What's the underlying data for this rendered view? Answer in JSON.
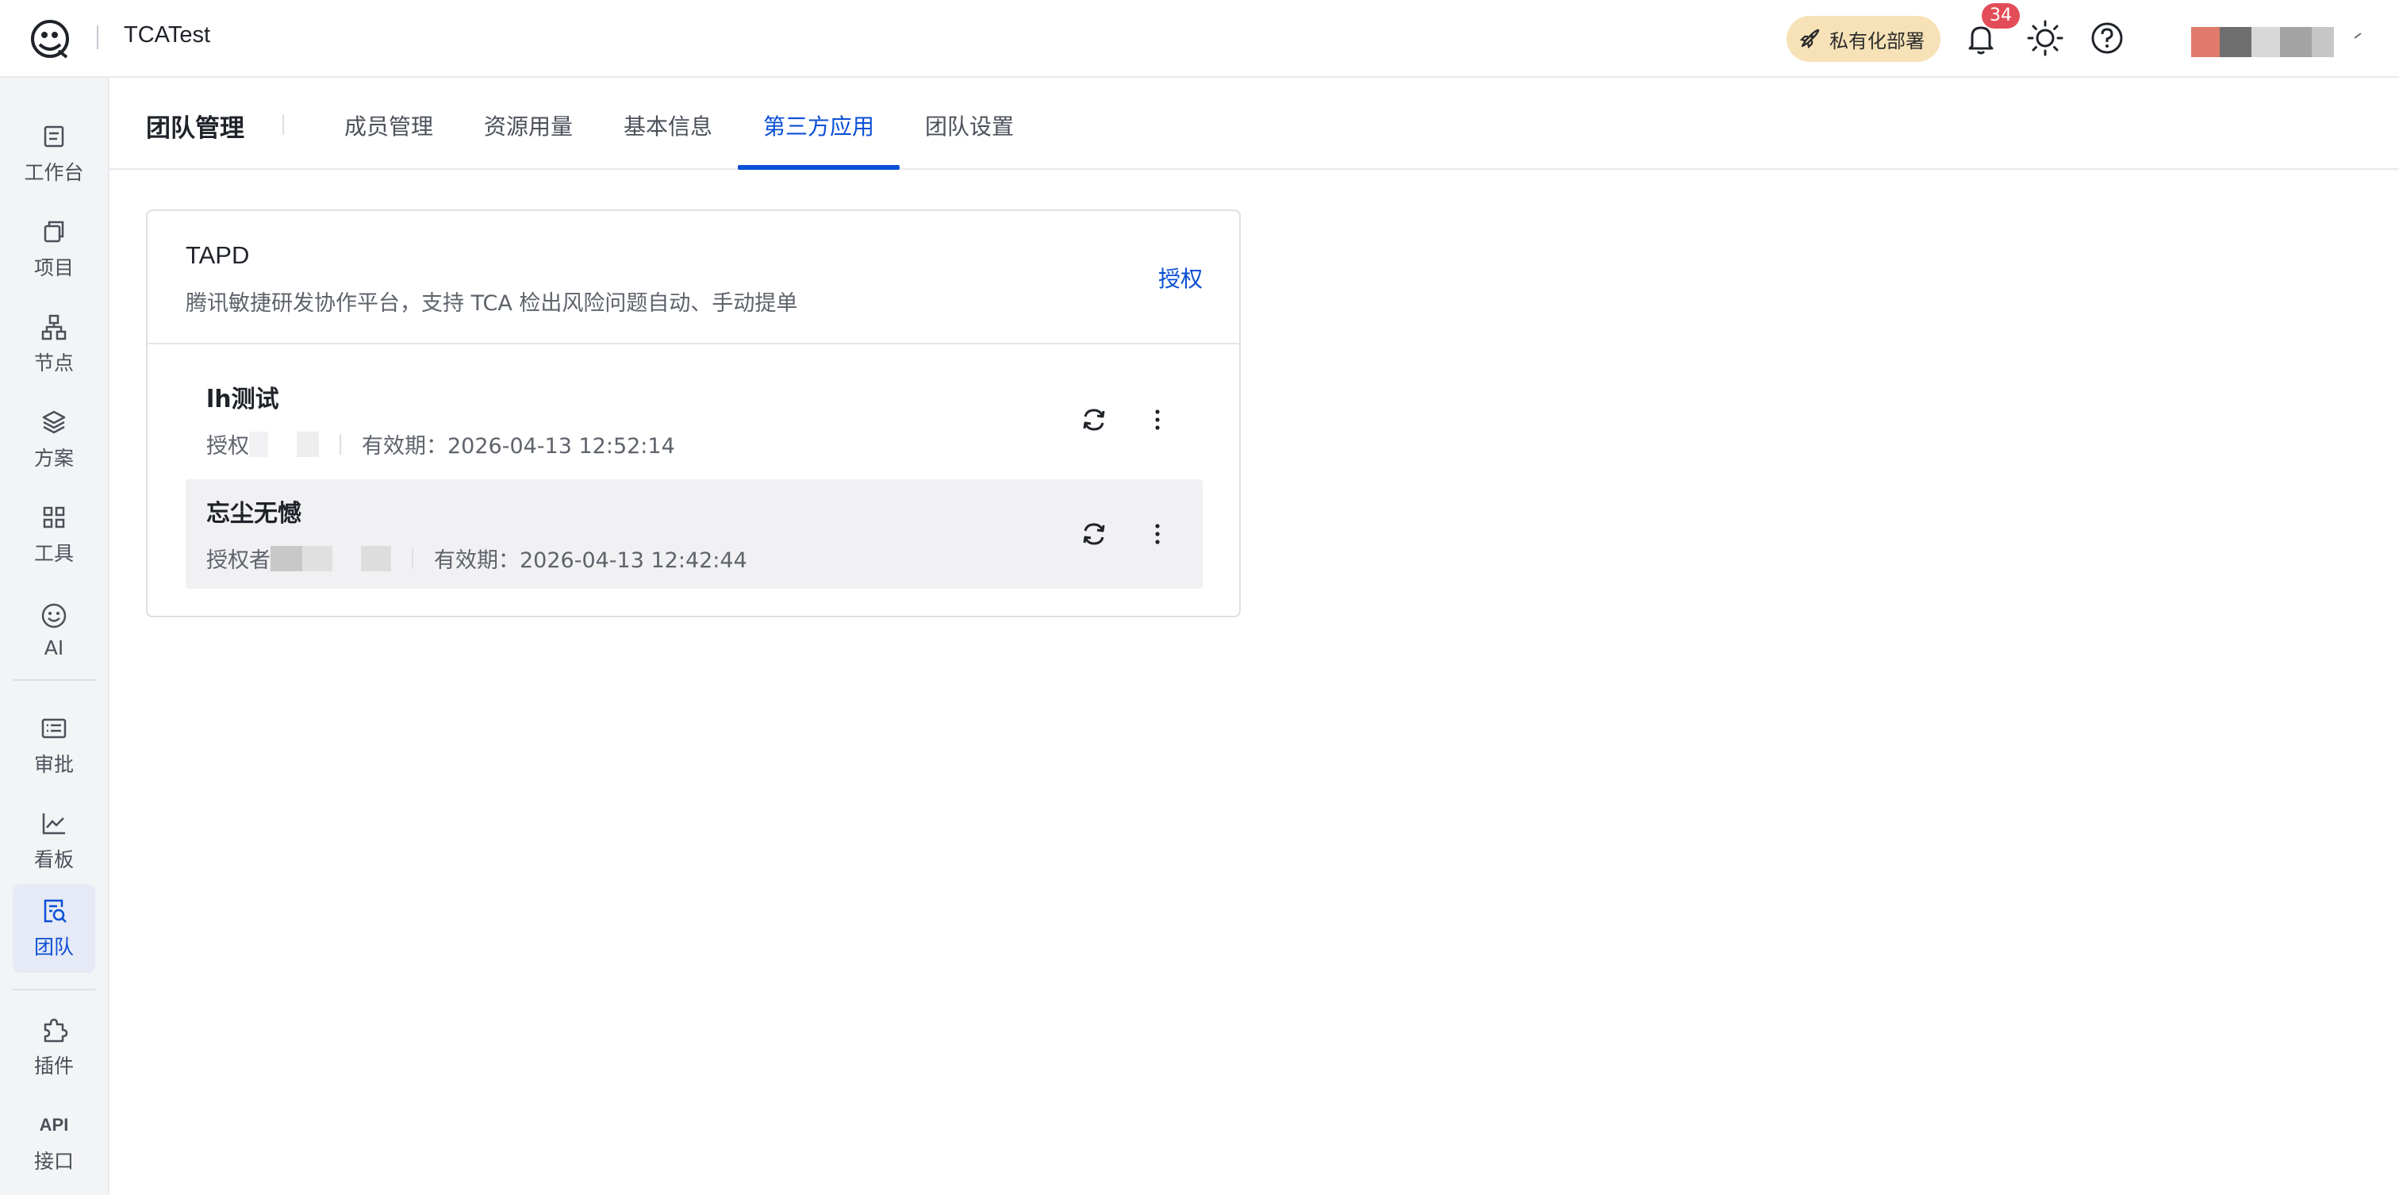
{
  "header": {
    "app_name": "TCATest",
    "deploy_label": "私有化部署",
    "notification_count": "34",
    "icons": [
      "logo-icon",
      "rocket-icon",
      "bell-icon",
      "sun-icon",
      "help-icon",
      "chevron-down-icon"
    ]
  },
  "sidebar": {
    "items": [
      {
        "label": "工作台",
        "icon": "workbench-icon"
      },
      {
        "label": "项目",
        "icon": "project-icon"
      },
      {
        "label": "节点",
        "icon": "node-icon"
      },
      {
        "label": "方案",
        "icon": "scheme-icon"
      },
      {
        "label": "工具",
        "icon": "tools-icon"
      },
      {
        "label": "AI",
        "icon": "ai-smile-icon"
      },
      {
        "label": "审批",
        "icon": "approval-icon"
      },
      {
        "label": "看板",
        "icon": "dashboard-icon"
      },
      {
        "label": "团队",
        "icon": "team-icon",
        "active": true
      },
      {
        "label": "插件",
        "icon": "plugin-icon"
      },
      {
        "label": "接口",
        "icon": "api-icon",
        "icon_text": "API"
      }
    ]
  },
  "page": {
    "title": "团队管理",
    "tabs": [
      {
        "label": "成员管理"
      },
      {
        "label": "资源用量"
      },
      {
        "label": "基本信息"
      },
      {
        "label": "第三方应用",
        "active": true
      },
      {
        "label": "团队设置"
      }
    ]
  },
  "integration": {
    "name": "TAPD",
    "description": "腾讯敏捷研发协作平台，支持 TCA 检出风险问题自动、手动提单",
    "authorize_label": "授权",
    "authorizations": [
      {
        "name": "lh测试",
        "authorizer_label": "授权",
        "expiry": "有效期：2026-04-13 12:52:14"
      },
      {
        "name": "忘尘无憾",
        "authorizer_label": "授权者",
        "expiry": "有效期：2026-04-13 12:42:44"
      }
    ]
  },
  "colors": {
    "accent": "#0a4fd6",
    "badge": "#e34d59",
    "deploy_bg": "#f7e2b8",
    "sidebar_bg": "#f3f4f6"
  }
}
